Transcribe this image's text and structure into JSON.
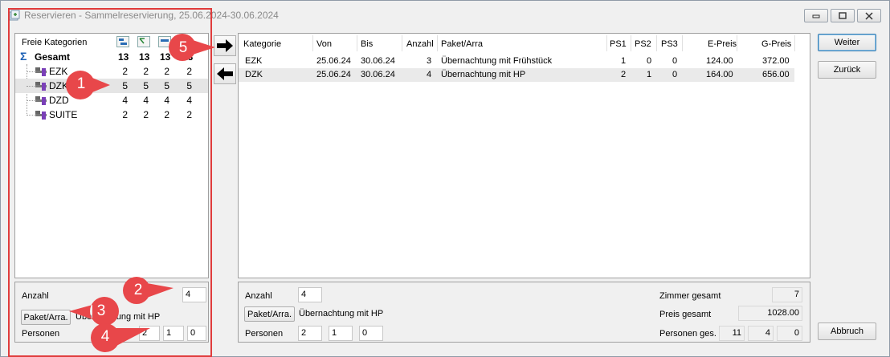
{
  "window": {
    "title": "Reservieren - Sammelreservierung, 25.06.2024-30.06.2024",
    "controls": {
      "minimize": "▭",
      "maximize": "□",
      "close": "✕"
    }
  },
  "left_panel": {
    "header": "Freie Kategorien",
    "root": {
      "label": "Gesamt",
      "counts": [
        "13",
        "13",
        "13",
        "13"
      ]
    },
    "items": [
      {
        "label": "EZK",
        "counts": [
          "2",
          "2",
          "2",
          "2"
        ]
      },
      {
        "label": "DZK",
        "counts": [
          "5",
          "5",
          "5",
          "5"
        ]
      },
      {
        "label": "DZD",
        "counts": [
          "4",
          "4",
          "4",
          "4"
        ]
      },
      {
        "label": "SUITE",
        "counts": [
          "2",
          "2",
          "2",
          "2"
        ]
      }
    ],
    "anzahl_label": "Anzahl",
    "anzahl_value": "4",
    "paket_button": "Paket/Arra.",
    "paket_value": "Übernachtung mit HP",
    "personen_label": "Personen",
    "personen_values": [
      "2",
      "1",
      "0"
    ]
  },
  "move": {
    "right_arrow": "➡",
    "left_arrow": "⬅"
  },
  "table": {
    "columns": [
      "Kategorie",
      "Von",
      "Bis",
      "Anzahl",
      "Paket/Arra",
      "PS1",
      "PS2",
      "PS3",
      "E-Preis",
      "G-Preis"
    ],
    "rows": [
      [
        "EZK",
        "25.06.24",
        "30.06.24",
        "3",
        "Übernachtung mit Frühstück",
        "1",
        "0",
        "0",
        "124.00",
        "372.00"
      ],
      [
        "DZK",
        "25.06.24",
        "30.06.24",
        "4",
        "Übernachtung mit HP",
        "2",
        "1",
        "0",
        "164.00",
        "656.00"
      ]
    ]
  },
  "right_bottom": {
    "anzahl_label": "Anzahl",
    "anzahl_value": "4",
    "paket_button": "Paket/Arra.",
    "paket_value": "Übernachtung mit HP",
    "personen_label": "Personen",
    "personen_values": [
      "2",
      "1",
      "0"
    ],
    "zimmer_label": "Zimmer gesamt",
    "zimmer_value": "7",
    "preis_label": "Preis gesamt",
    "preis_value": "1028.00",
    "personen_ges_label": "Personen ges.",
    "personen_ges_values": [
      "11",
      "4",
      "0"
    ]
  },
  "buttons": {
    "weiter": "Weiter",
    "zurueck": "Zurück",
    "abbruch": "Abbruch"
  },
  "callouts": [
    "1",
    "2",
    "3",
    "4",
    "5"
  ],
  "colors": {
    "highlight_box": "#e03c3c",
    "callout_fill": "#e8474a",
    "selection": "#e5e5e5",
    "sigma": "#1a5fb4"
  }
}
